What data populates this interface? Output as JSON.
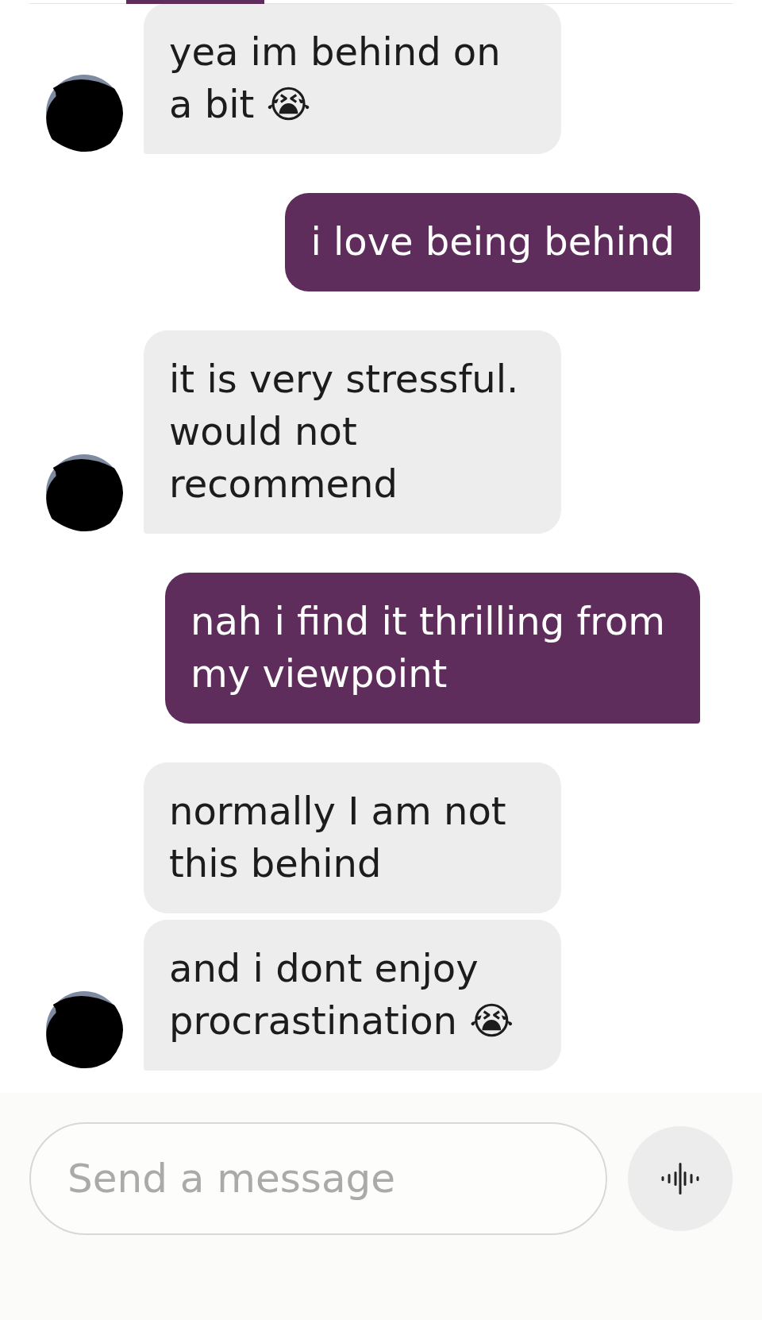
{
  "header": {
    "tab_indicator": true
  },
  "messages": [
    {
      "kind": "received",
      "avatar": true,
      "text": "yea im behind on a bit 😭"
    },
    {
      "kind": "sent",
      "avatar": false,
      "text": "i love being behind"
    },
    {
      "kind": "received",
      "avatar": true,
      "text": "it is very stressful. would not recommend"
    },
    {
      "kind": "sent",
      "avatar": false,
      "text": "nah i find it thrilling from my viewpoint"
    },
    {
      "kind": "received",
      "avatar": false,
      "text": "normally I am not this behind"
    },
    {
      "kind": "received",
      "avatar": true,
      "text": "and i dont enjoy procrastination 😭"
    }
  ],
  "composer": {
    "placeholder": "Send a message"
  }
}
